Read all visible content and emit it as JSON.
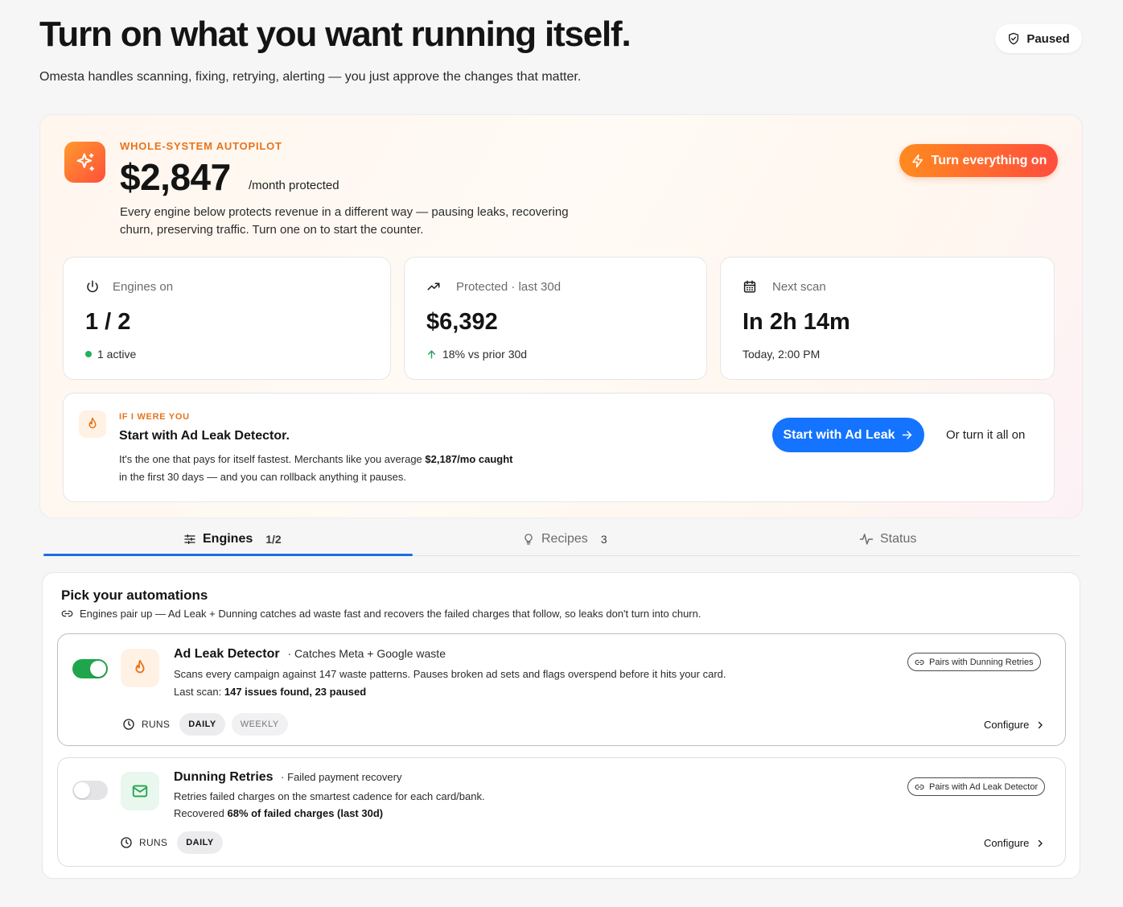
{
  "header": {
    "title": "Turn on what you want running itself.",
    "subtitle": "Omesta handles scanning, fixing, retrying, alerting — you just approve the changes that matter.",
    "status_label": "Paused"
  },
  "hero": {
    "eyebrow": "WHOLE-SYSTEM AUTOPILOT",
    "amount": "$2,847",
    "amount_suffix": "/month protected",
    "description": "Every engine below protects revenue in a different way — pausing leaks, recovering churn, preserving traffic. Turn one on to start the counter.",
    "cta_label": "Turn everything on",
    "stats": [
      {
        "label": "Engines on",
        "value": "1 / 2",
        "foot": "1 active",
        "icon": "power-icon"
      },
      {
        "label": "Protected · last 30d",
        "value": "$6,392",
        "foot": "18% vs prior 30d",
        "icon": "trend-up-icon"
      },
      {
        "label": "Next scan",
        "value": "In 2h 14m",
        "foot": "Today, 2:00 PM",
        "icon": "calendar-icon"
      }
    ],
    "recommendation": {
      "eyebrow": "IF I WERE YOU",
      "title": "Start with Ad Leak Detector.",
      "desc_pre": "It's the one that pays for itself fastest. Merchants like you average ",
      "desc_bold": "$2,187/mo caught",
      "desc_post": " in the first 30 days — and you can rollback anything it pauses.",
      "primary_label": "Start with Ad Leak",
      "secondary_label": "Or turn it all on"
    }
  },
  "tabs": [
    {
      "label": "Engines",
      "count": "1/2",
      "active": true
    },
    {
      "label": "Recipes",
      "count": "3",
      "active": false
    },
    {
      "label": "Status",
      "count": "",
      "active": false
    }
  ],
  "automations": {
    "title": "Pick your automations",
    "subtitle": "Engines pair up — Ad Leak + Dunning catches ad waste fast and recovers the failed charges that follow, so leaks don't turn into churn.",
    "runs_label": "RUNS",
    "configure_label": "Configure",
    "engines": [
      {
        "name": "Ad Leak Detector",
        "tag": "Catches Meta + Google waste",
        "description": "Scans every campaign against 147 waste patterns. Pauses broken ad sets and flags overspend before it hits your card.",
        "stat_label": "Last scan: ",
        "stat_value": "147 issues found, 23 paused",
        "pairs_with": "Pairs with Dunning Retries",
        "enabled": true,
        "schedule_options": [
          "DAILY",
          "WEEKLY"
        ],
        "schedule_selected": "DAILY",
        "icon": "flame-icon",
        "accent": "#e8741a"
      },
      {
        "name": "Dunning Retries",
        "tag": "Failed payment recovery",
        "description": "Retries failed charges on the smartest cadence for each card/bank.",
        "stat_label": "Recovered ",
        "stat_value": "68% of failed charges (last 30d)",
        "pairs_with": "Pairs with Ad Leak Detector",
        "enabled": false,
        "schedule_options": [
          "DAILY"
        ],
        "schedule_selected": "DAILY",
        "icon": "mail-icon",
        "accent": "#1fa64d"
      }
    ]
  },
  "colors": {
    "accent_orange": "#ff8a1f",
    "accent_blue": "#1473ff",
    "success_green": "#1fa64d"
  }
}
